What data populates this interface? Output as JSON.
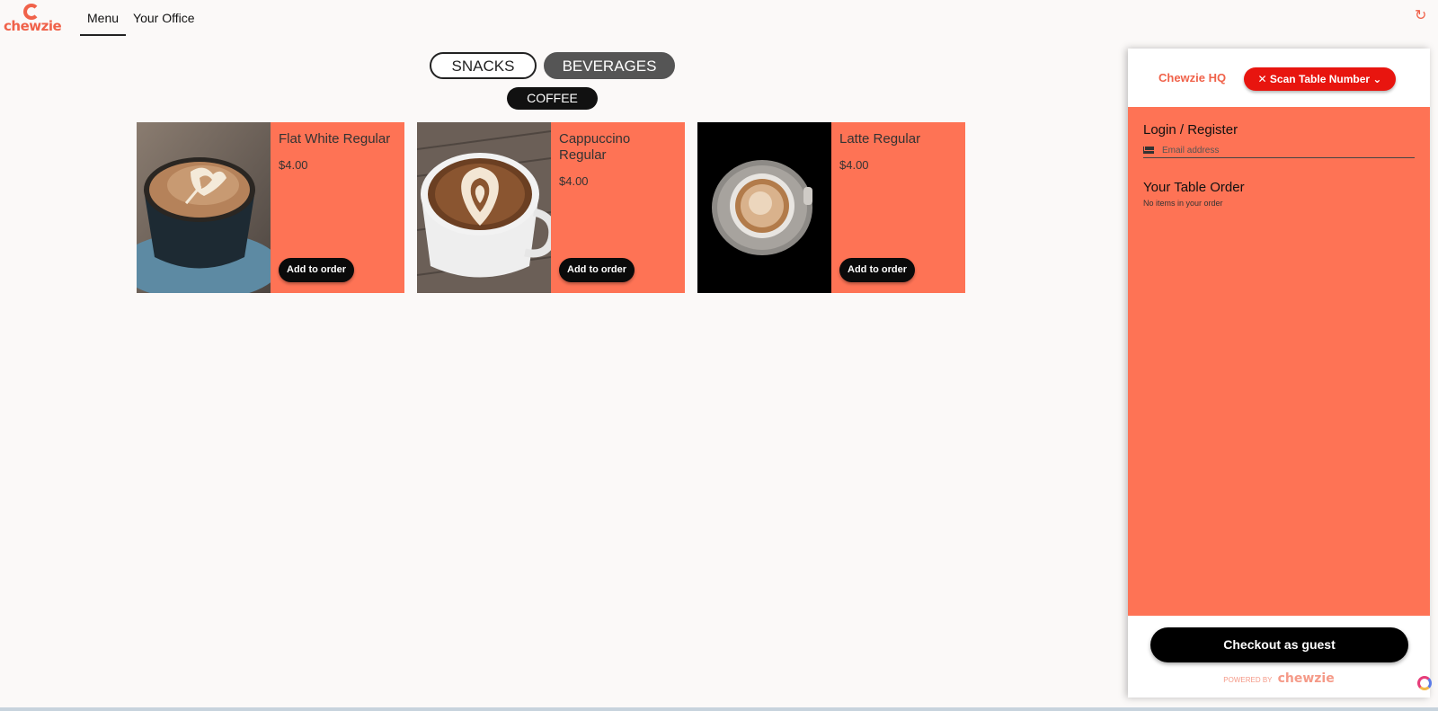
{
  "brand": {
    "logo_text": "chewzie"
  },
  "nav": {
    "items": [
      {
        "label": "Menu",
        "active": true
      },
      {
        "label": "Your Office",
        "active": false
      }
    ]
  },
  "categories": {
    "snacks": "SNACKS",
    "beverages": "BEVERAGES",
    "subcategory": "COFFEE"
  },
  "products": [
    {
      "name": "Flat White Regular",
      "price": "$4.00",
      "button": "Add to order"
    },
    {
      "name": "Cappuccino Regular",
      "price": "$4.00",
      "button": "Add to order"
    },
    {
      "name": "Latte Regular",
      "price": "$4.00",
      "button": "Add to order"
    }
  ],
  "sidebar": {
    "venue": "Chewzie HQ",
    "scan_button": "Scan Table Number",
    "login_title": "Login / Register",
    "email_placeholder": "Email address",
    "order_title": "Your Table Order",
    "order_empty": "No items in your order",
    "checkout_button": "Checkout as guest",
    "powered_by": "POWERED BY",
    "powered_brand": "chewzie"
  },
  "colors": {
    "accent": "#fe7355",
    "brand": "#f0624a",
    "scan": "#e8150f",
    "dark": "#0a0a0a"
  },
  "icons": {
    "refresh": "refresh-icon",
    "mail": "mail-icon",
    "scan": "utensils-icon",
    "help": "help-icon"
  }
}
